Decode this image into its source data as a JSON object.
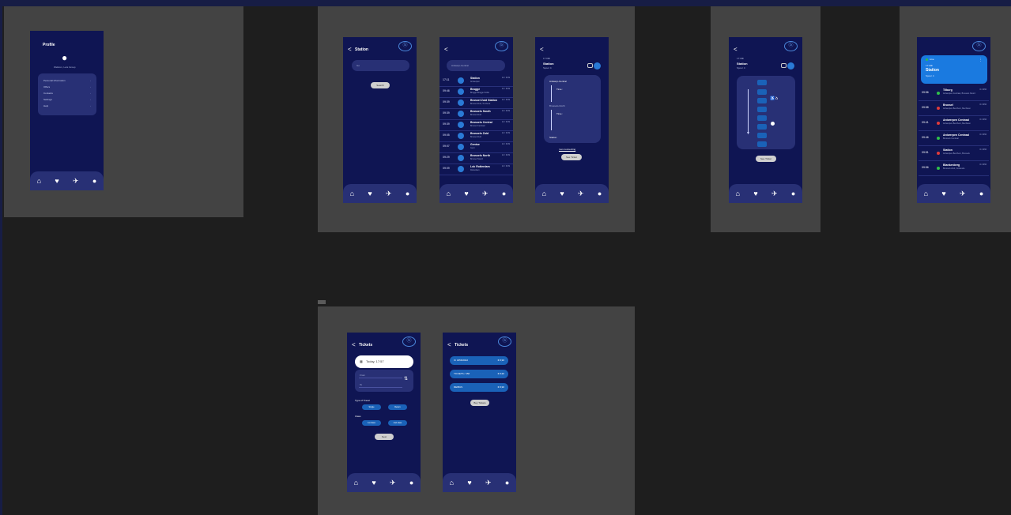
{
  "colors": {
    "canvas": "#1e1e1e",
    "frame": "#434343",
    "screen": "#0f1553",
    "nav": "#283075",
    "accent": "#1a62b8"
  },
  "nav_icons": [
    "home-icon",
    "heart-icon",
    "ticket-icon",
    "user-icon"
  ],
  "nav_glyphs": [
    "⌂",
    "♥",
    "✈",
    "●"
  ],
  "logo_glyph": "ⓑ",
  "back_glyph": "<",
  "profile": {
    "title": "Profile",
    "avatar_glyph": "●",
    "username": "Welkom, Lars Groep",
    "menu": [
      "Personal Information",
      "Offers",
      "Contacts",
      "Settings",
      "Help"
    ]
  },
  "search_station": {
    "title": "Station",
    "input_placeholder": "Go",
    "button": "Search"
  },
  "departures": {
    "search_value": "Antwerp-Central",
    "rows": [
      {
        "time": "17:11",
        "name": "Station",
        "sub": "Antwerpen",
        "meta": "12 / IC09"
      },
      {
        "time": "09:46",
        "name": "Brugge",
        "sub": "Brugge Brugge Noble",
        "meta": "12 / IC09"
      },
      {
        "time": "09:39",
        "name": "Brussel Zuid Station",
        "sub": "Brussel Zuid, Turnhout",
        "meta": "12 / IC09"
      },
      {
        "time": "09:39",
        "name": "Brussels South",
        "sub": "Brussel Zuid",
        "meta": "12 / IC09"
      },
      {
        "time": "09:39",
        "name": "Brussels Central",
        "sub": "Brussel Centraal",
        "meta": "12 / IC09"
      },
      {
        "time": "09:05",
        "name": "Brussels Zuid",
        "sub": "Brussel Zuid",
        "meta": "12 / IC09"
      },
      {
        "time": "09:07",
        "name": "Gentse",
        "sub": "Gent",
        "meta": "12 / IC09"
      },
      {
        "time": "09:29",
        "name": "Brussels North",
        "sub": "Brussel Noord",
        "meta": "12 / IC09"
      },
      {
        "time": "09:09",
        "name": "Lok Rotterdam",
        "sub": "Rotterdam",
        "meta": "12 / IC09"
      }
    ]
  },
  "trip_detail": {
    "time": "17:09h",
    "station": "Station",
    "platform": "Spoor 4",
    "stops": [
      "Antwerp-Central",
      "Brussels-North",
      "Station"
    ],
    "info": [
      "Time :",
      "Time :"
    ],
    "link": "I am connecting",
    "button": "See Ticket"
  },
  "train_composition": {
    "time": "17:09h",
    "station": "Station",
    "platform": "Spoor 4",
    "button": "See Ticket"
  },
  "live": {
    "badge": "Live",
    "card_label": "17:09h",
    "card_title": "Station",
    "card_sub": "Spoor 4",
    "rows": [
      {
        "time": "09:56",
        "name": "Tilburg",
        "sub": "Antwerpen-Centraal, Brussels Noord",
        "meta": "IC 3456",
        "dot": "#2fbf4a"
      },
      {
        "time": "09:58",
        "name": "Brussel",
        "sub": "Antwerpen-Berchem, Mechelen",
        "meta": "IC 3456",
        "dot": "#e03b3b"
      },
      {
        "time": "09:41",
        "name": "Antwerpen Centraal",
        "sub": "Antwerpen-Berchem, Mechelen",
        "meta": "IC 3456",
        "dot": "#e03b3b"
      },
      {
        "time": "09:46",
        "name": "Antwerpen Centraal",
        "sub": "Brussels Centraal",
        "meta": "IC 3456",
        "dot": "#2fbf4a"
      },
      {
        "time": "09:51",
        "name": "Station",
        "sub": "Antwerpen-Berchem, Brussels",
        "meta": "IC 3456",
        "dot": "#e03b3b"
      },
      {
        "time": "09:56",
        "name": "Blankenberg",
        "sub": "Brussels Zuid, Oostende",
        "meta": "IC 3456",
        "dot": "#2fbf4a"
      }
    ]
  },
  "tickets_search": {
    "title": "Tickets",
    "date_value": "Today, 17:57",
    "from_placeholder": "From",
    "to_placeholder": "To",
    "type_label": "Type of Travel",
    "type_options": [
      "Single",
      "Return"
    ],
    "class_label": "Class",
    "class_options": [
      "1st class",
      "2nd class"
    ],
    "button": "Next"
  },
  "tickets_list": {
    "title": "Tickets",
    "items": [
      {
        "name": "IC 3456/2022",
        "price": "€ 8,90"
      },
      {
        "name": "TICKETS / 456",
        "price": "€ 8,90"
      },
      {
        "name": "REIBUS",
        "price": "€ 8,90"
      }
    ],
    "button": "Buy Tickets"
  }
}
